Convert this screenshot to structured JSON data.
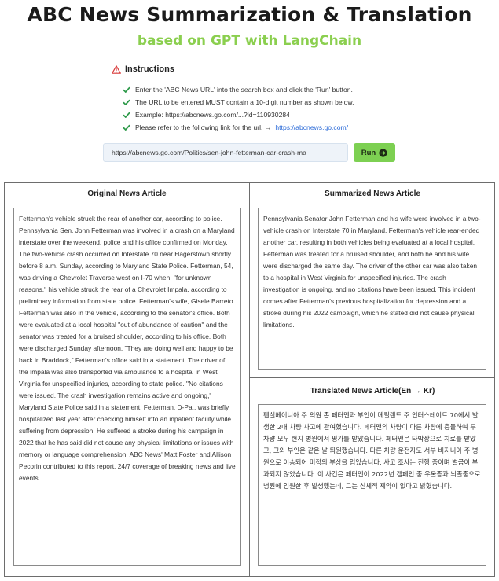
{
  "header": {
    "title": "ABC News Summarization & Translation",
    "subtitle": "based on GPT with LangChain"
  },
  "instructions": {
    "heading": "Instructions",
    "items": [
      "Enter the 'ABC News URL' into the search box and click the 'Run' button.",
      "The URL to be entered MUST contain a 10-digit number as shown below.",
      "Example: https://abcnews.go.com/...?id=110930284",
      "Please refer to the following link for the url. →"
    ],
    "link_text": "https://abcnews.go.com/"
  },
  "search": {
    "url_value": "https://abcnews.go.com/Politics/sen-john-fetterman-car-crash-ma",
    "run_label": "Run"
  },
  "panels": {
    "original": {
      "title": "Original News Article",
      "text": "Fetterman's vehicle struck the rear of another car, according to police. Pennsylvania Sen. John Fetterman was involved in a crash on a Maryland interstate over the weekend, police and his office confirmed on Monday. The two-vehicle crash occurred on Interstate 70 near Hagerstown shortly before 8 a.m. Sunday, according to Maryland State Police. Fetterman, 54, was driving a Chevrolet Traverse west on I-70 when, \"for unknown reasons,\" his vehicle struck the rear of a Chevrolet Impala, according to preliminary information from state police. Fetterman's wife, Gisele Barreto Fetterman was also in the vehicle, according to the senator's office. Both were evaluated at a local hospital \"out of abundance of caution\" and the senator was treated for a bruised shoulder, according to his office. Both were discharged Sunday afternoon. \"They are doing well and happy to be back in Braddock,\" Fetterman's office said in a statement. The driver of the Impala was also transported via ambulance to a hospital in West Virginia for unspecified injuries, according to state police. \"No citations were issued. The crash investigation remains active and ongoing,\" Maryland State Police said in a statement. Fetterman, D-Pa., was briefly hospitalized last year after checking himself into an inpatient facility while suffering from depression. He suffered a stroke during his campaign in 2022 that he has said did not cause any physical limitations or issues with memory or language comprehension. ABC News' Matt Foster and Allison Pecorin contributed to this report. 24/7 coverage of breaking news and live events"
    },
    "summary": {
      "title": "Summarized News Article",
      "text": "Pennsylvania Senator John Fetterman and his wife were involved in a two-vehicle crash on Interstate 70 in Maryland. Fetterman's vehicle rear-ended another car, resulting in both vehicles being evaluated at a local hospital. Fetterman was treated for a bruised shoulder, and both he and his wife were discharged the same day. The driver of the other car was also taken to a hospital in West Virginia for unspecified injuries. The crash investigation is ongoing, and no citations have been issued. This incident comes after Fetterman's previous hospitalization for depression and a stroke during his 2022 campaign, which he stated did not cause physical limitations."
    },
    "translated": {
      "title": "Translated News Article(En → Kr)",
      "text": "펜실베이니아 주 의원 존 페터맨과 부인이 메릴랜드 주 인터스테이트 70에서 발생한 2대 차량 사고에 관여했습니다. 페터맨의 차량이 다른 차량에 충돌하여 두 차량 모두 현지 병원에서 평가를 받았습니다. 페터맨은 타박상으로 치료를 받았고, 그와 부인은 같은 날 퇴원했습니다. 다른 차량 운전자도 서부 버지니아 주 병원으로 이송되어 미정의 부상을 입었습니다. 사고 조사는 진행 중이며 벌금이 부과되지 않았습니다. 이 사건은 페터맨이 2022년 캠페인 중 우울증과 뇌졸중으로 병원에 입원한 후 발생했는데, 그는 신체적 제약이 없다고 밝혔습니다."
    }
  },
  "colors": {
    "subtitle": "#8bcf4f",
    "run_button": "#7dd052",
    "check": "#2e9a4a",
    "warning": "#d93a3a",
    "link": "#2a6ad8"
  }
}
